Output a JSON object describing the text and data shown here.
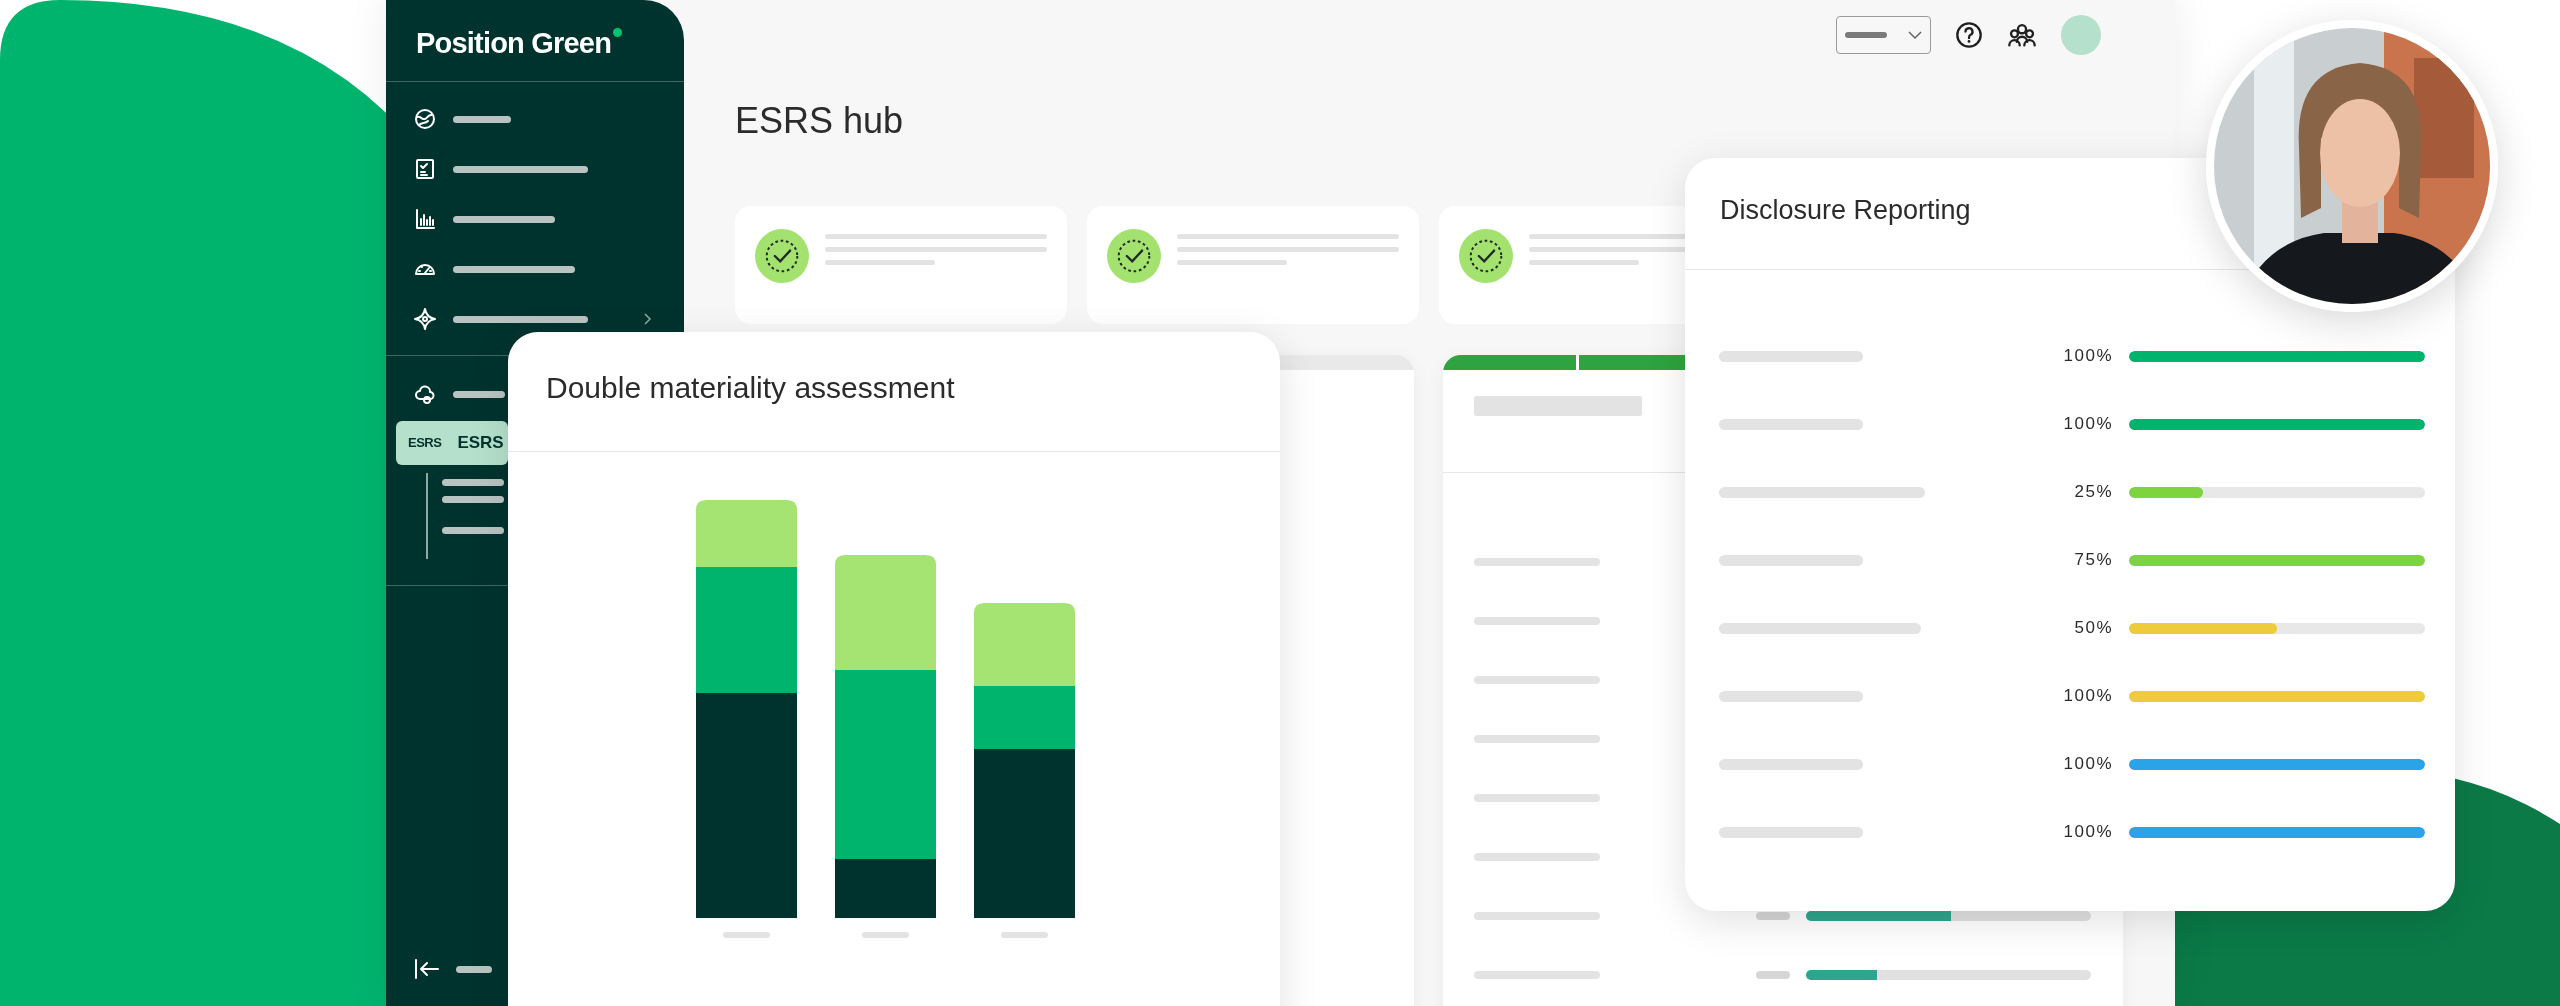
{
  "sidebar": {
    "logo": "Position Green",
    "sections": [
      {
        "items": [
          {
            "kind": "globe",
            "selected": false
          },
          {
            "kind": "checklist",
            "selected": false
          },
          {
            "kind": "chart",
            "selected": false
          },
          {
            "kind": "gauge",
            "selected": false
          },
          {
            "kind": "sparkle",
            "selected": false
          }
        ]
      },
      {
        "items": [
          {
            "kind": "cloud",
            "selected": false
          },
          {
            "kind": "text",
            "badge": "ESRS",
            "label": "ESRS",
            "selected": true,
            "expanded": true
          }
        ]
      }
    ]
  },
  "page": {
    "title": "ESRS hub"
  },
  "materiality_card": {
    "title": "Double materiality assessment"
  },
  "status_table": {
    "rows": [
      {
        "level": 0.51
      },
      {
        "level": 0.25
      }
    ]
  },
  "disclosure_reporting": {
    "title": "Disclosure Reporting",
    "rows": [
      {
        "reading": "100%",
        "level": 1,
        "color": "#00b46e"
      },
      {
        "reading": "100%",
        "level": 1,
        "color": "#00b46e"
      },
      {
        "reading": "25%",
        "level": 0.25,
        "color": "#7ed43f"
      },
      {
        "reading": "75%",
        "level": 1,
        "color": "#7ed43f"
      },
      {
        "reading": "50%",
        "level": 0.5,
        "color": "#eecb3c"
      },
      {
        "reading": "100%",
        "level": 1,
        "color": "#eecb3c"
      },
      {
        "reading": "100%",
        "level": 1,
        "color": "#2aa3e8"
      },
      {
        "reading": "100%",
        "level": 1,
        "color": "#2aa3e8"
      }
    ]
  }
}
